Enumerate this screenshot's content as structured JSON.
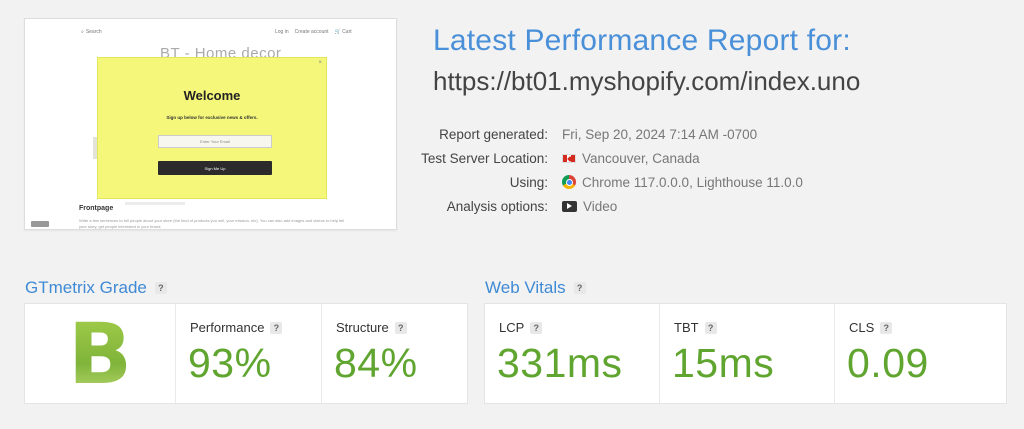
{
  "thumbnail": {
    "search_label": "Search",
    "links": [
      "Log in",
      "Create account",
      "Cart"
    ],
    "store_title": "BT - Home decor",
    "popup": {
      "close": "×",
      "title": "Welcome",
      "subtitle": "Sign up below for exclusive news & offers.",
      "email_placeholder": "Enter Your Email",
      "button_label": "Sign Me Up",
      "background_color": "#f4f77a"
    },
    "frontpage_title": "Frontpage",
    "frontpage_text": "Write a few sentences to tell people about your store (the kind of products you sell, your mission, etc). You can also add images and videos to help tell your story, get people interested in your brand."
  },
  "report": {
    "title": "Latest Performance Report for:",
    "url": "https://bt01.myshopify.com/index.uno",
    "meta": [
      {
        "key": "Report generated:",
        "value": "Fri, Sep 20, 2024 7:14 AM -0700",
        "icon": ""
      },
      {
        "key": "Test Server Location:",
        "value": "Vancouver, Canada",
        "icon": "canada-flag-icon"
      },
      {
        "key": "Using:",
        "value": "Chrome 117.0.0.0, Lighthouse 11.0.0",
        "icon": "chrome-icon"
      },
      {
        "key": "Analysis options:",
        "value": "Video",
        "icon": "video-icon"
      }
    ]
  },
  "grade": {
    "section_title": "GTmetrix Grade",
    "help": "?",
    "letter": "B",
    "metrics": [
      {
        "label": "Performance",
        "help": "?",
        "value": "93%"
      },
      {
        "label": "Structure",
        "help": "?",
        "value": "84%"
      }
    ]
  },
  "vitals": {
    "section_title": "Web Vitals",
    "help": "?",
    "metrics": [
      {
        "label": "LCP",
        "help": "?",
        "value": "331ms"
      },
      {
        "label": "TBT",
        "help": "?",
        "value": "15ms"
      },
      {
        "label": "CLS",
        "help": "?",
        "value": "0.09"
      }
    ]
  },
  "colors": {
    "title_blue": "#4a90d9",
    "good_green": "#5fa52f",
    "background": "#f2f2f2"
  }
}
